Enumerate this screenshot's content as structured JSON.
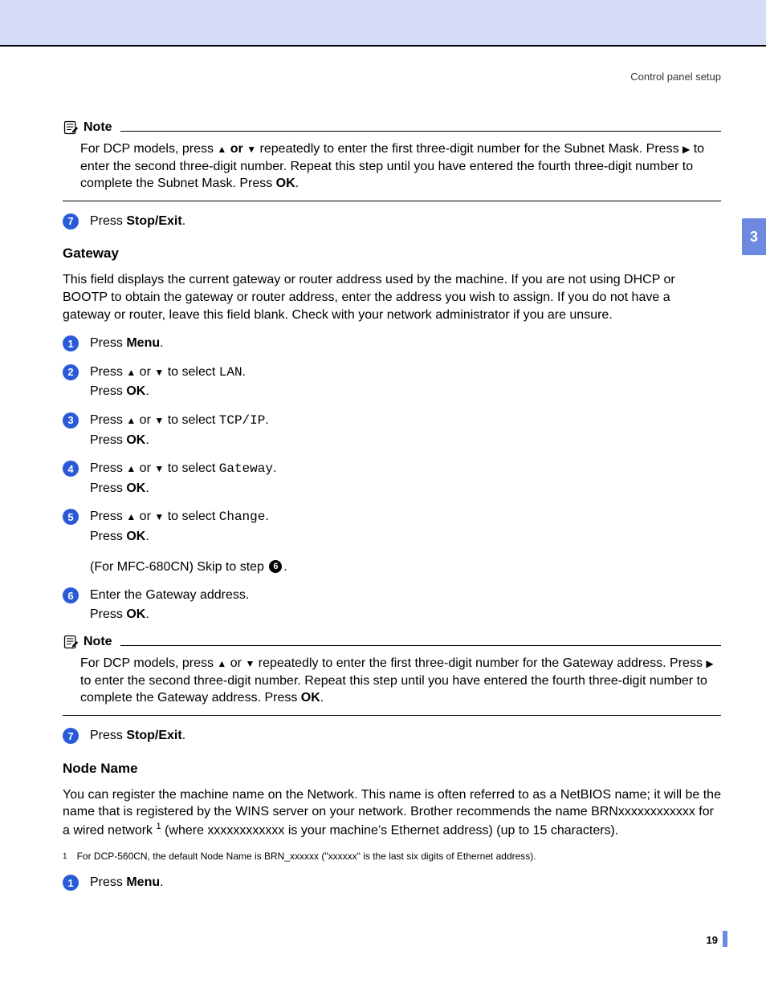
{
  "header": {
    "breadcrumb": "Control panel setup"
  },
  "sideTab": "3",
  "pageNumber": "19",
  "note1": {
    "label": "Note",
    "body_pre": "For DCP models, press ",
    "up": "▲",
    "or_bold": " or ",
    "down": "▼",
    "body_mid": " repeatedly to enter the first three-digit number for the Subnet Mask. Press ",
    "right": "▶",
    "body_mid2": " to enter the second three-digit number. Repeat this step until you have entered the fourth three-digit number to complete the Subnet Mask. Press ",
    "ok": "OK",
    "body_end": "."
  },
  "step7a": {
    "num": "7",
    "pre": "Press ",
    "bold": "Stop/Exit",
    "post": "."
  },
  "gateway": {
    "heading": "Gateway",
    "intro": "This field displays the current gateway or router address used by the machine. If you are not using DHCP or BOOTP to obtain the gateway or router address, enter the address you wish to assign. If you do not have a gateway or router, leave this field blank. Check with your network administrator if you are unsure."
  },
  "gsteps": {
    "s1": {
      "num": "1",
      "pre": "Press ",
      "bold": "Menu",
      "post": "."
    },
    "s2": {
      "num": "2",
      "pre": "Press ",
      "up": "▲",
      "or": " or ",
      "down": "▼",
      "mid": " to select ",
      "mono": "LAN",
      "post1": ".",
      "l2pre": "Press ",
      "l2bold": "OK",
      "l2post": "."
    },
    "s3": {
      "num": "3",
      "pre": "Press ",
      "up": "▲",
      "or": " or ",
      "down": "▼",
      "mid": " to select ",
      "mono": "TCP/IP",
      "post1": ".",
      "l2pre": "Press ",
      "l2bold": "OK",
      "l2post": "."
    },
    "s4": {
      "num": "4",
      "pre": "Press ",
      "up": "▲",
      "or": " or ",
      "down": "▼",
      "mid": " to select ",
      "mono": "Gateway",
      "post1": ".",
      "l2pre": "Press ",
      "l2bold": "OK",
      "l2post": "."
    },
    "s5": {
      "num": "5",
      "pre": "Press ",
      "up": "▲",
      "or": " or ",
      "down": "▼",
      "mid": " to select ",
      "mono": "Change",
      "post1": ".",
      "l2pre": "Press ",
      "l2bold": "OK",
      "l2post": ".",
      "l3pre": "(For MFC-680CN) Skip to step ",
      "l3badge": "6",
      "l3post": "."
    },
    "s6": {
      "num": "6",
      "l1": "Enter the Gateway address.",
      "l2pre": "Press ",
      "l2bold": "OK",
      "l2post": "."
    }
  },
  "note2": {
    "label": "Note",
    "body_pre": "For DCP models, press ",
    "up": "▲",
    "or": " or ",
    "down": "▼",
    "body_mid": " repeatedly to enter the first three-digit number for the Gateway address. Press ",
    "right": "▶",
    "body_mid2": " to enter the second three-digit number. Repeat this step until you have entered the fourth three-digit number to complete the Gateway address. Press ",
    "ok": "OK",
    "body_end": "."
  },
  "step7b": {
    "num": "7",
    "pre": "Press ",
    "bold": "Stop/Exit",
    "post": "."
  },
  "node": {
    "heading": "Node Name",
    "p_pre": "You can register the machine name on the Network. This name is often referred to as a NetBIOS name; it will be the name that is registered by the WINS server on your network. Brother recommends the name BRNxxxxxxxxxxxx for a wired network ",
    "sup": "1",
    "p_post": " (where xxxxxxxxxxxx is your machine’s Ethernet address) (up to 15 characters)."
  },
  "footnote": {
    "num": "1",
    "text": "For DCP-560CN, the default Node Name is BRN_xxxxxx  (\"xxxxxx\" is the last six digits of Ethernet address)."
  },
  "nstep1": {
    "num": "1",
    "pre": "Press ",
    "bold": "Menu",
    "post": "."
  }
}
